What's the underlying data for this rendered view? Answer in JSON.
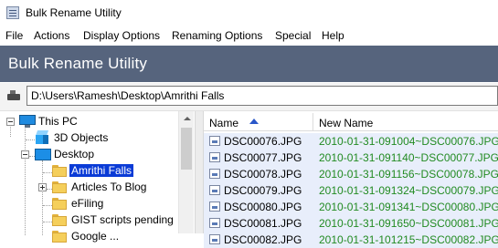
{
  "window": {
    "title": "Bulk Rename Utility"
  },
  "menu": [
    "File",
    "Actions",
    "Display Options",
    "Renaming Options",
    "Special",
    "Help"
  ],
  "banner": {
    "title": "Bulk Rename Utility"
  },
  "path": {
    "value": "D:\\Users\\Ramesh\\Desktop\\Amrithi Falls"
  },
  "tree": {
    "this_pc": "This PC",
    "objects_3d": "3D Objects",
    "desktop": "Desktop",
    "amrithi_falls": "Amrithi Falls",
    "articles_to_blog": "Articles To Blog",
    "efiling": "eFiling",
    "gist_scripts": "GIST scripts pending",
    "partial_last": "Google ..."
  },
  "file_list": {
    "columns": {
      "name": "Name",
      "new_name": "New Name"
    },
    "rows": [
      {
        "name": "DSC00076.JPG",
        "new_name": "2010-01-31-091004~DSC00076.JPG"
      },
      {
        "name": "DSC00077.JPG",
        "new_name": "2010-01-31-091140~DSC00077.JPG"
      },
      {
        "name": "DSC00078.JPG",
        "new_name": "2010-01-31-091156~DSC00078.JPG"
      },
      {
        "name": "DSC00079.JPG",
        "new_name": "2010-01-31-091324~DSC00079.JPG"
      },
      {
        "name": "DSC00080.JPG",
        "new_name": "2010-01-31-091341~DSC00080.JPG"
      },
      {
        "name": "DSC00081.JPG",
        "new_name": "2010-01-31-091650~DSC00081.JPG"
      },
      {
        "name": "DSC00082.JPG",
        "new_name": "2010-01-31-101215~DSC00082.JPG"
      }
    ]
  },
  "colors": {
    "banner": "#56647d",
    "selection": "#0a3bd6",
    "new_name_text": "#228b22",
    "row_highlight": "#e8eefb"
  }
}
